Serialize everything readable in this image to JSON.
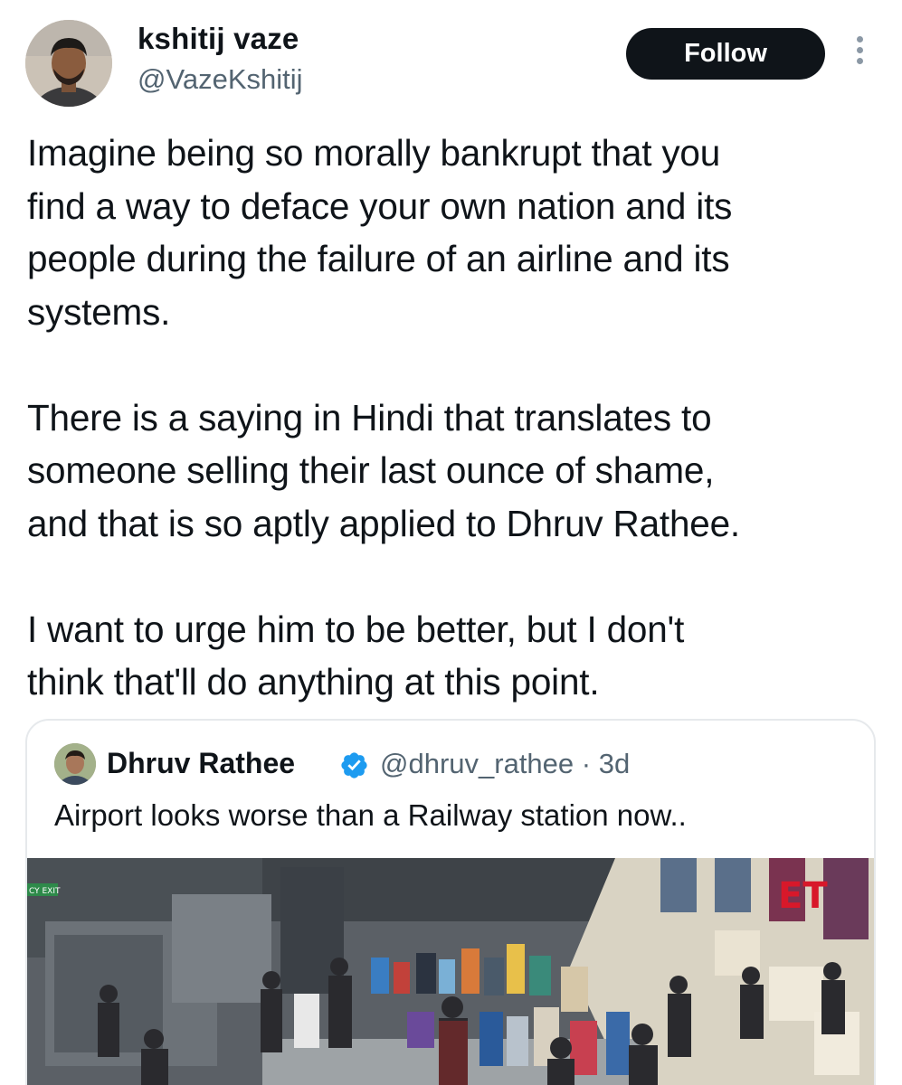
{
  "tweet": {
    "author_name": "kshitij vaze",
    "author_handle": "@VazeKshitij",
    "follow_label": "Follow",
    "text_lines": [
      "Imagine being so morally bankrupt that you",
      "find a way to deface your own nation and its",
      "people during the failure of an airline and its",
      "systems.",
      "",
      "There is a saying in Hindi that translates to",
      "someone selling their last ounce of shame,",
      "and that is so aptly applied to Dhruv Rathee.",
      "",
      "I want to urge him to be better, but I don't",
      "think that'll do anything at this point."
    ]
  },
  "quoted": {
    "author_name": "Dhruv Rathee",
    "author_handle": "@dhruv_rathee",
    "separator": "·",
    "time": "3d",
    "text": "Airport looks worse than a Railway station now..",
    "image_sign": "CY EXIT",
    "image_logo": "ET"
  },
  "icons": {
    "more": "more-vertical-icon",
    "verified": "verified-badge-icon"
  },
  "colors": {
    "text": "#0f1419",
    "secondary": "#536471",
    "follow_bg": "#0f1419",
    "verified": "#1d9bf0",
    "border": "#e6e9ec"
  }
}
